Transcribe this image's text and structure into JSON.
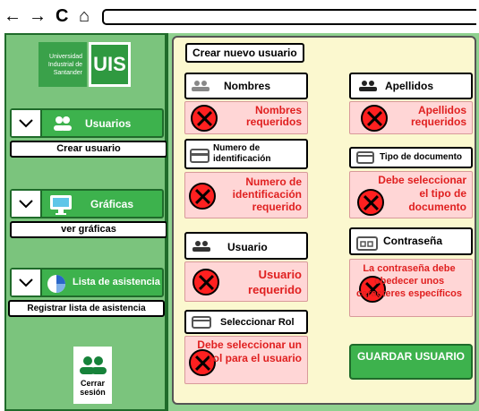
{
  "browser": {
    "back": "←",
    "forward": "→",
    "reload": "C",
    "home": "⌂"
  },
  "logo": {
    "text_left": "Universidad Industrial de Santander",
    "text_right": "UIS"
  },
  "sidebar": {
    "menus": [
      {
        "label": "Usuarios",
        "sub": "Crear usuario",
        "icon": "users-icon"
      },
      {
        "label": "Gráficas",
        "sub": "ver gráficas",
        "icon": "monitor-icon"
      },
      {
        "label": "Lista de asistencia",
        "sub": "Registrar lista de asistencia",
        "icon": "pie-icon"
      }
    ],
    "logout": "Cerrar sesión"
  },
  "form": {
    "title": "Crear nuevo usuario",
    "fields": {
      "nombres": {
        "label": "Nombres",
        "error": "Nombres requeridos"
      },
      "apellidos": {
        "label": "Apellidos",
        "error": "Apellidos requeridos"
      },
      "numero": {
        "label": "Numero de identificación",
        "error": "Numero de identificación requerido"
      },
      "tipo": {
        "label": "Tipo de documento",
        "error": "Debe seleccionar el tipo de documento"
      },
      "usuario": {
        "label": "Usuario",
        "error": "Usuario requerido"
      },
      "contrasena": {
        "label": "Contraseña",
        "error": "La contraseña debe obedecer unos caracteres específicos"
      },
      "rol": {
        "label": "Seleccionar Rol",
        "error": "Debe seleccionar un rol para el usuario"
      }
    },
    "save": "GUARDAR USUARIO"
  },
  "colors": {
    "accent": "#3db24d",
    "error": "#e02020",
    "error_bg": "#ffd6d6",
    "panel": "#fbf8cf"
  }
}
